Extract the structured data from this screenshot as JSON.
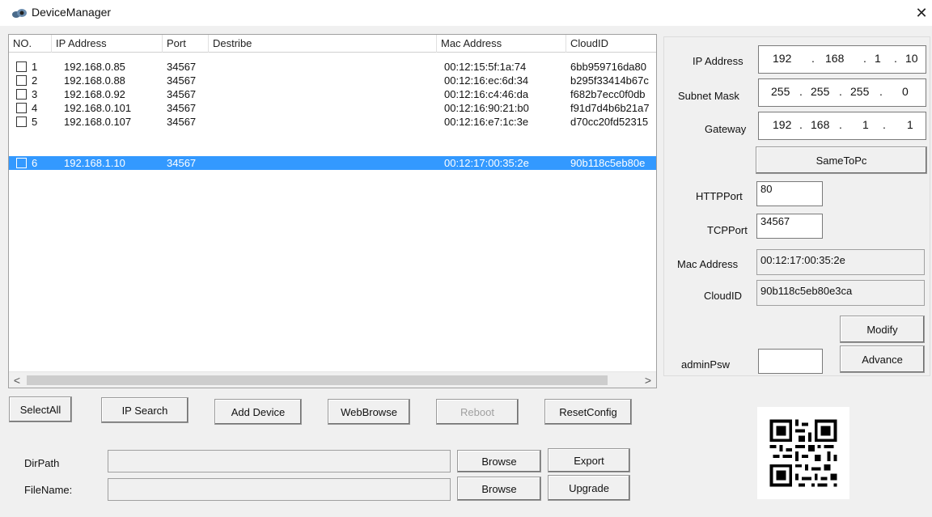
{
  "window": {
    "title": "DeviceManager",
    "close_glyph": "✕"
  },
  "list": {
    "columns": [
      "NO.",
      "IP Address",
      "Port",
      "Destribe",
      "Mac Address",
      "CloudID"
    ],
    "rows": [
      {
        "no": "1",
        "ip": "192.168.0.85",
        "port": "34567",
        "describe": "",
        "mac": "00:12:15:5f:1a:74",
        "cloud": "6bb959716da80"
      },
      {
        "no": "2",
        "ip": "192.168.0.88",
        "port": "34567",
        "describe": "",
        "mac": "00:12:16:ec:6d:34",
        "cloud": "b295f33414b67c"
      },
      {
        "no": "3",
        "ip": "192.168.0.92",
        "port": "34567",
        "describe": "",
        "mac": "00:12:16:c4:46:da",
        "cloud": "f682b7ecc0f0db"
      },
      {
        "no": "4",
        "ip": "192.168.0.101",
        "port": "34567",
        "describe": "",
        "mac": "00:12:16:90:21:b0",
        "cloud": "f91d7d4b6b21a7"
      },
      {
        "no": "5",
        "ip": "192.168.0.107",
        "port": "34567",
        "describe": "",
        "mac": "00:12:16:e7:1c:3e",
        "cloud": "d70cc20fd52315"
      },
      {
        "no": "6",
        "ip": "192.168.1.10",
        "port": "34567",
        "describe": "",
        "mac": "00:12:17:00:35:2e",
        "cloud": "90b118c5eb80e"
      }
    ],
    "selected_row": "6",
    "scroll_left": "<",
    "scroll_right": ">"
  },
  "buttons": {
    "select_all": "SelectAll",
    "ip_search": "IP Search",
    "add_device": "Add Device",
    "web_browse": "WebBrowse",
    "reboot": "Reboot",
    "reset_config": "ResetConfig",
    "browse1": "Browse",
    "browse2": "Browse",
    "export": "Export",
    "upgrade": "Upgrade"
  },
  "files": {
    "dir_label": "DirPath",
    "file_label": "FileName:",
    "dir_value": "",
    "file_value": ""
  },
  "panel": {
    "ip_label": "IP Address",
    "ip": [
      "192",
      "168",
      "1",
      "10"
    ],
    "mask_label": "Subnet Mask",
    "mask": [
      "255",
      "255",
      "255",
      "0"
    ],
    "gw_label": "Gateway",
    "gw": [
      "192",
      "168",
      "1",
      "1"
    ],
    "dot": ".",
    "same_to_pc": "SameToPc",
    "http_label": "HTTPPort",
    "http": "80",
    "tcp_label": "TCPPort",
    "tcp": "34567",
    "mac_label": "Mac Address",
    "mac": "00:12:17:00:35:2e",
    "cloud_label": "CloudID",
    "cloud": "90b118c5eb80e3ca",
    "modify": "Modify",
    "advance": "Advance",
    "admin_label": "adminPsw",
    "admin_value": ""
  },
  "colors": {
    "selection": "#3399ff",
    "window_bg": "#f0f0f0"
  }
}
